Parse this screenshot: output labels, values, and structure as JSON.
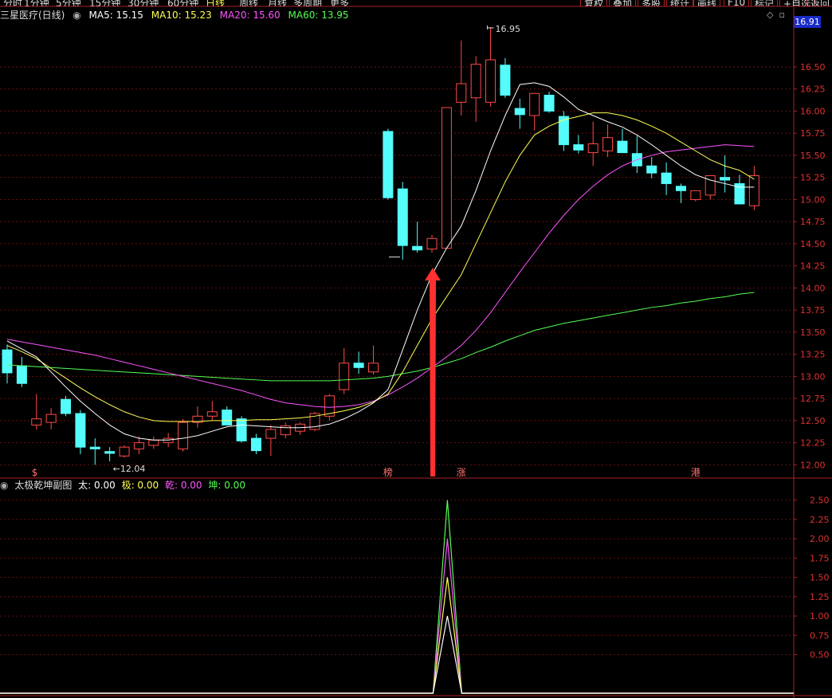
{
  "toolbar": {
    "items": [
      "分时",
      "1分钟",
      "5分钟",
      "15分钟",
      "30分钟",
      "60分钟",
      "日线",
      "周线",
      "月线",
      "多周期",
      "更多"
    ],
    "active": "日线",
    "right_items": [
      "复权",
      "叠加",
      "多股",
      "统计",
      "画线",
      "F10",
      "标记",
      "+自选",
      "返回"
    ]
  },
  "header": {
    "stock": "三星医疗(日线)",
    "ma5": "MA5: 15.15",
    "ma10": "MA10: 15.23",
    "ma20": "MA20: 15.60",
    "ma60": "MA60: 13.95",
    "current_price": "16.91",
    "icons": [
      "diamond-icon",
      "window-icon"
    ]
  },
  "sub_header": {
    "title": "太极乾坤副图",
    "tai": "太: 0.00",
    "ji": "极: 0.00",
    "qian": "乾: 0.00",
    "kun": "坤: 0.00"
  },
  "colors": {
    "up": "#ff4a4a",
    "down": "#54fcfc",
    "ma5": "#ffffff",
    "ma10": "#ffff54",
    "ma20": "#ff54ff",
    "ma60": "#54ff54",
    "axis": "#aa2222",
    "grid": "#661111"
  },
  "chart_data": [
    {
      "type": "candlestick",
      "title": "三星医疗(日线)",
      "ylim": [
        11.85,
        16.95
      ],
      "yticks": [
        12.0,
        12.25,
        12.5,
        12.75,
        13.0,
        13.25,
        13.5,
        13.75,
        14.0,
        14.25,
        14.5,
        14.75,
        15.0,
        15.25,
        15.5,
        15.75,
        16.0,
        16.25,
        16.5
      ],
      "annotations": [
        {
          "label": "16.95",
          "type": "high"
        },
        {
          "label": "12.04",
          "type": "low"
        },
        {
          "label": "$",
          "type": "marker"
        },
        {
          "label": "榜",
          "type": "marker"
        },
        {
          "label": "涨",
          "type": "marker"
        },
        {
          "label": "港",
          "type": "marker"
        }
      ],
      "ohlc": [
        [
          13.3,
          13.36,
          12.92,
          13.04
        ],
        [
          13.12,
          13.22,
          12.88,
          12.92
        ],
        [
          12.45,
          12.8,
          12.4,
          12.52
        ],
        [
          12.48,
          12.64,
          12.4,
          12.57
        ],
        [
          12.74,
          12.78,
          12.55,
          12.58
        ],
        [
          12.58,
          12.62,
          12.12,
          12.2
        ],
        [
          12.2,
          12.3,
          12.0,
          12.18
        ],
        [
          12.15,
          12.2,
          12.04,
          12.13
        ],
        [
          12.1,
          12.22,
          12.08,
          12.2
        ],
        [
          12.18,
          12.32,
          12.12,
          12.25
        ],
        [
          12.22,
          12.32,
          12.18,
          12.28
        ],
        [
          12.25,
          12.36,
          12.2,
          12.3
        ],
        [
          12.18,
          12.52,
          12.15,
          12.48
        ],
        [
          12.48,
          12.66,
          12.42,
          12.55
        ],
        [
          12.55,
          12.72,
          12.5,
          12.6
        ],
        [
          12.62,
          12.66,
          12.45,
          12.45
        ],
        [
          12.52,
          12.55,
          12.25,
          12.27
        ],
        [
          12.3,
          12.35,
          12.12,
          12.16
        ],
        [
          12.3,
          12.45,
          12.1,
          12.4
        ],
        [
          12.34,
          12.48,
          12.3,
          12.44
        ],
        [
          12.38,
          12.48,
          12.34,
          12.46
        ],
        [
          12.4,
          12.6,
          12.38,
          12.58
        ],
        [
          12.55,
          12.8,
          12.5,
          12.78
        ],
        [
          12.85,
          13.32,
          12.8,
          13.15
        ],
        [
          13.15,
          13.28,
          13.03,
          13.1
        ],
        [
          13.05,
          13.35,
          13.02,
          13.15
        ],
        [
          15.77,
          15.8,
          15.0,
          15.02
        ],
        [
          15.12,
          15.2,
          14.32,
          14.48
        ],
        [
          14.47,
          14.75,
          14.4,
          14.43
        ],
        [
          14.44,
          14.6,
          14.4,
          14.56
        ],
        [
          14.45,
          16.04,
          14.45,
          16.04
        ],
        [
          16.1,
          16.8,
          15.95,
          16.31
        ],
        [
          16.15,
          16.62,
          15.88,
          16.53
        ],
        [
          16.1,
          16.95,
          16.05,
          16.58
        ],
        [
          16.52,
          16.6,
          16.15,
          16.18
        ],
        [
          16.03,
          16.14,
          15.8,
          15.96
        ],
        [
          15.95,
          16.18,
          15.78,
          16.2
        ],
        [
          16.18,
          16.22,
          15.98,
          16.0
        ],
        [
          15.94,
          16.0,
          15.55,
          15.62
        ],
        [
          15.62,
          15.73,
          15.52,
          15.56
        ],
        [
          15.53,
          15.88,
          15.38,
          15.63
        ],
        [
          15.55,
          15.85,
          15.48,
          15.7
        ],
        [
          15.66,
          15.8,
          15.55,
          15.53
        ],
        [
          15.52,
          15.72,
          15.3,
          15.38
        ],
        [
          15.38,
          15.48,
          15.24,
          15.3
        ],
        [
          15.3,
          15.42,
          15.05,
          15.18
        ],
        [
          15.15,
          15.18,
          14.96,
          15.1
        ],
        [
          15.0,
          15.1,
          14.98,
          15.1
        ],
        [
          15.05,
          15.25,
          15.0,
          15.27
        ],
        [
          15.25,
          15.5,
          15.08,
          15.22
        ],
        [
          15.18,
          15.28,
          14.98,
          14.95
        ],
        [
          14.93,
          15.38,
          14.88,
          15.27
        ]
      ],
      "ma5": [
        13.4,
        13.31,
        13.22,
        13.05,
        12.88,
        12.72,
        12.58,
        12.45,
        12.35,
        12.3,
        12.28,
        12.28,
        12.3,
        12.33,
        12.38,
        12.43,
        12.45,
        12.44,
        12.43,
        12.42,
        12.42,
        12.43,
        12.46,
        12.52,
        12.6,
        12.7,
        12.85,
        13.3,
        13.75,
        14.15,
        14.45,
        14.7,
        15.1,
        15.55,
        15.95,
        16.3,
        16.32,
        16.28,
        16.16,
        16.02,
        15.95,
        15.88,
        15.82,
        15.73,
        15.62,
        15.5,
        15.38,
        15.28,
        15.22,
        15.18,
        15.14,
        15.14
      ],
      "ma10": [
        13.35,
        13.28,
        13.2,
        13.09,
        12.98,
        12.87,
        12.77,
        12.68,
        12.6,
        12.54,
        12.5,
        12.49,
        12.49,
        12.49,
        12.5,
        12.5,
        12.5,
        12.51,
        12.51,
        12.52,
        12.53,
        12.55,
        12.58,
        12.61,
        12.65,
        12.71,
        12.8,
        13.05,
        13.35,
        13.65,
        13.9,
        14.15,
        14.5,
        14.85,
        15.2,
        15.5,
        15.73,
        15.83,
        15.9,
        15.94,
        15.98,
        15.98,
        15.95,
        15.9,
        15.83,
        15.75,
        15.65,
        15.55,
        15.45,
        15.38,
        15.33,
        15.23
      ],
      "ma20": [
        13.42,
        13.39,
        13.36,
        13.33,
        13.3,
        13.27,
        13.24,
        13.2,
        13.16,
        13.12,
        13.08,
        13.04,
        13.0,
        12.96,
        12.92,
        12.88,
        12.84,
        12.79,
        12.74,
        12.7,
        12.68,
        12.66,
        12.65,
        12.66,
        12.68,
        12.72,
        12.79,
        12.88,
        12.98,
        13.1,
        13.22,
        13.35,
        13.52,
        13.72,
        13.95,
        14.18,
        14.4,
        14.62,
        14.82,
        15.0,
        15.15,
        15.28,
        15.38,
        15.45,
        15.5,
        15.54,
        15.56,
        15.58,
        15.6,
        15.62,
        15.61,
        15.6
      ],
      "ma60": [
        13.13,
        13.12,
        13.11,
        13.1,
        13.09,
        13.08,
        13.07,
        13.06,
        13.05,
        13.04,
        13.03,
        13.02,
        13.01,
        13.0,
        12.99,
        12.98,
        12.97,
        12.96,
        12.95,
        12.95,
        12.95,
        12.95,
        12.95,
        12.96,
        12.97,
        12.98,
        13.0,
        13.03,
        13.06,
        13.1,
        13.15,
        13.2,
        13.27,
        13.33,
        13.4,
        13.46,
        13.52,
        13.56,
        13.6,
        13.63,
        13.66,
        13.69,
        13.72,
        13.75,
        13.78,
        13.8,
        13.83,
        13.85,
        13.88,
        13.9,
        13.93,
        13.95
      ]
    },
    {
      "type": "line",
      "title": "太极乾坤副图",
      "ylim": [
        0,
        2.6
      ],
      "yticks": [
        0.5,
        0.75,
        1.0,
        1.25,
        1.5,
        1.75,
        2.0,
        2.25,
        2.5
      ],
      "spike_index": 30,
      "series": [
        {
          "name": "坤",
          "peak": 2.5
        },
        {
          "name": "乾",
          "peak": 2.0
        },
        {
          "name": "极",
          "peak": 1.5
        },
        {
          "name": "太",
          "peak": 1.0
        }
      ]
    }
  ]
}
